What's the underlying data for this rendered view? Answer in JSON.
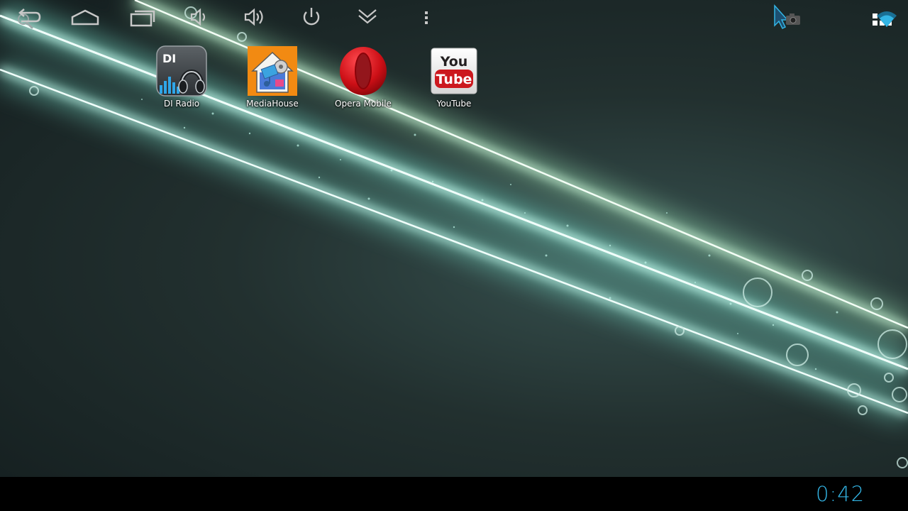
{
  "home": {
    "apps": [
      {
        "label": "DI Radio",
        "icon": "di-radio-icon"
      },
      {
        "label": "MediaHouse",
        "icon": "mediahouse-icon"
      },
      {
        "label": "Opera Mobile",
        "icon": "opera-icon"
      },
      {
        "label": "YouTube",
        "icon": "youtube-icon"
      }
    ],
    "di_icon_text": "DI",
    "youtube_top": "You",
    "youtube_bottom": "Tube"
  },
  "top_bar": {
    "search_icon": "search-icon",
    "app_drawer_icon": "app-drawer-icon"
  },
  "nav_bar": {
    "buttons": [
      "back-icon",
      "home-icon",
      "recent-apps-icon",
      "volume-down-icon",
      "volume-up-icon",
      "power-icon",
      "hide-bar-icon",
      "menu-icon"
    ],
    "status_icons": [
      "screenshot-cursor-icon",
      "wifi-icon"
    ],
    "clock": "0:42"
  },
  "colors": {
    "accent": "#33b5e5",
    "navbar_bg": "#000000",
    "youtube_red": "#cc181e",
    "opera_red": "#cc0f16"
  }
}
